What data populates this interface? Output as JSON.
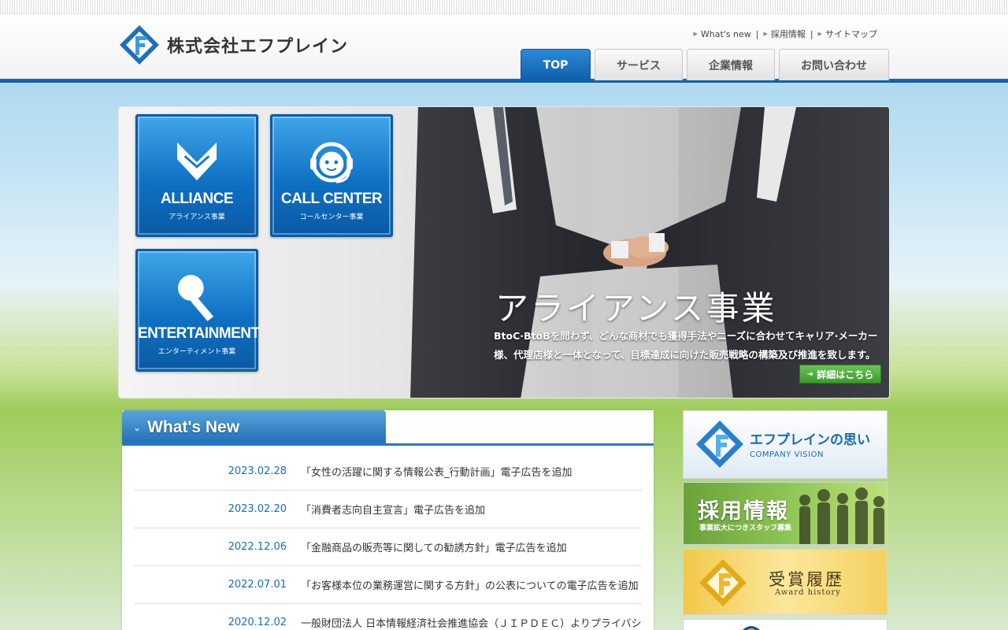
{
  "company": {
    "name": "株式会社エフプレイン"
  },
  "util_nav": [
    {
      "label": "What's new"
    },
    {
      "label": "採用情報"
    },
    {
      "label": "サイトマップ"
    }
  ],
  "global_nav": [
    {
      "label": "TOP",
      "active": true
    },
    {
      "label": "サービス",
      "active": false
    },
    {
      "label": "企業情報",
      "active": false
    },
    {
      "label": "お問い合わせ",
      "active": false
    }
  ],
  "hero": {
    "tiles": [
      {
        "name": "ALLIANCE",
        "sub": "アライアンス事業",
        "icon": "handshake-icon"
      },
      {
        "name": "CALL CENTER",
        "sub": "コールセンター事業",
        "icon": "headset-icon"
      },
      {
        "name": "ENTERTAINMENT",
        "sub": "エンターティメント事業",
        "icon": "microphone-icon"
      }
    ],
    "title": "アライアンス事業",
    "description": "BtoC·BtoBを問わず、どんな商材でも獲得手法やニーズに合わせてキャリア·メーカー様、代理店様と一体となって、目標達成に向けた販売戦略の構築及び推進を致します。",
    "button_label": "詳細はこちら"
  },
  "news": {
    "heading": "What's New",
    "items": [
      {
        "date": "2023.02.28",
        "title": "「女性の活躍に関する情報公表_行動計画」電子広告を追加"
      },
      {
        "date": "2023.02.20",
        "title": "「消費者志向自主宣言」電子広告を追加"
      },
      {
        "date": "2022.12.06",
        "title": "「金融商品の販売等に関しての勧誘方針」電子広告を追加"
      },
      {
        "date": "2022.07.01",
        "title": "「お客様本位の業務運営に関する方針」の公表についての電子広告を追加"
      },
      {
        "date": "2020.12.02",
        "title": "一般財団法人 日本情報経済社会推進協会（ＪＩＰＤＥＣ）よりプライバシ"
      }
    ]
  },
  "side_banners": {
    "vision": {
      "title": "エフプレインの思い",
      "sub": "COMPANY VISION"
    },
    "recruit": {
      "title": "採用情報",
      "sub": "事業拡大につきスタッフ募集"
    },
    "award": {
      "title": "受賞履歴",
      "sub": "Award history"
    }
  },
  "colors": {
    "brand_blue": "#1e6fb8",
    "accent_green": "#4aa836"
  }
}
